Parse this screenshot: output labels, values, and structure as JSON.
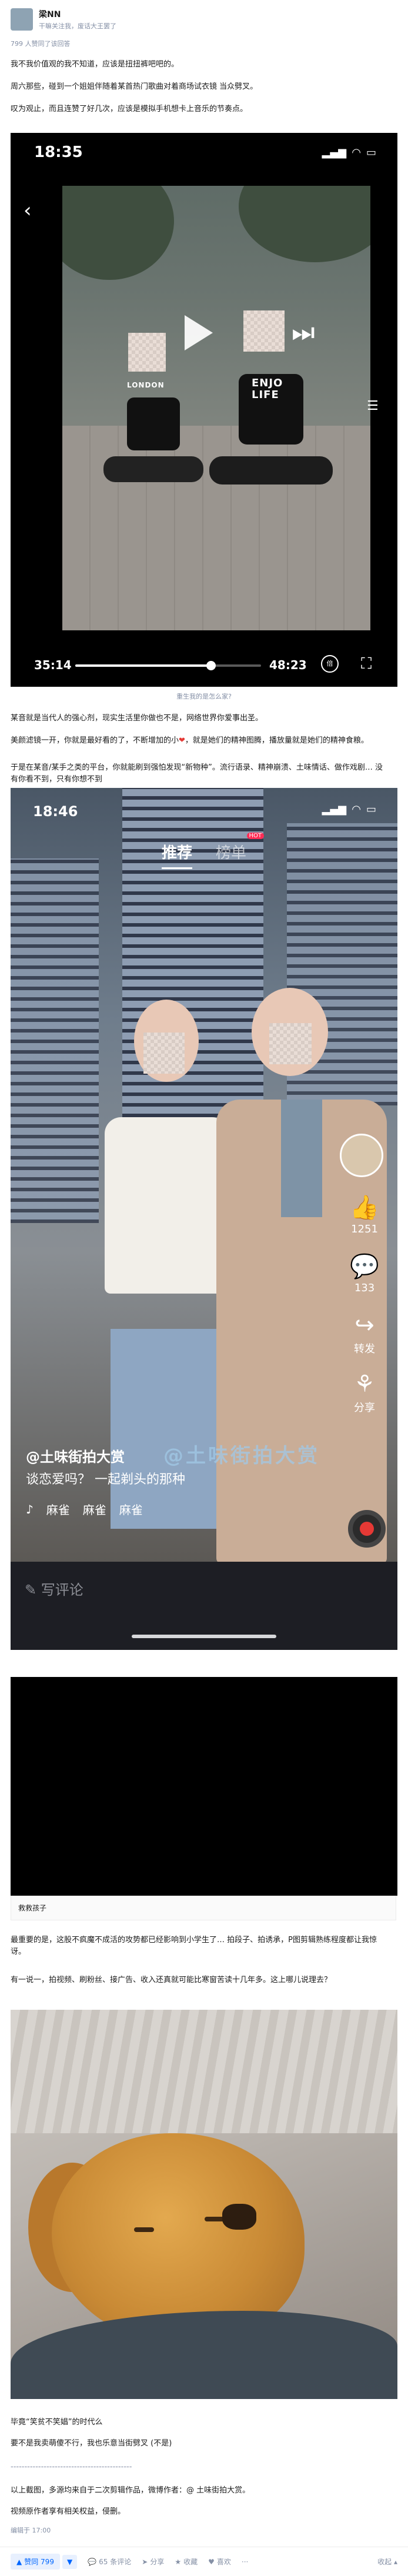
{
  "author": {
    "name": "梁NN",
    "bio": "干嘛关注我，废话大王罢了"
  },
  "vote_info": "799 人赞同了该回答",
  "paragraphs": {
    "p1": "我不我价值观的我不知道，应该是扭扭裤吧吧的。",
    "p2": "周六那些，碰到一个姐姐伴随着某首热门歌曲对着商场试衣镜 当众劈叉。",
    "p3": "叹为观止，而且连赞了好几次，应该是模拟手机想卡上音乐的节奏点。",
    "p4": "某音就是当代人的强心剂，现实生活里你做也不是，网络世界你爱事出圣。",
    "p5_a": "美颜滤镜一开，你就是最好看的了，不断增加的小",
    "p5_b": "，就是她们的精神图腾，播放量就是她们的精神食粮。",
    "p6": "于是在某音/某手之类的平台，你就能刷到强怕发现“新物种”。流行语录、精神崩溃、土味情话、做作戏剧… 没有你看不到，只有你想不到",
    "p7": "最重要的是，这股不疯魔不成活的攻势都已经影响到小学生了… 拍段子、拍诱承，P图剪辑熟练程度都让我惊讶。",
    "p8": "有一说一，拍视频、刷粉丝、接广告、收入还真就可能比寒窗苦读十几年多。这上哪儿说理去？",
    "p9": "毕竟“笑贫不笑娼”的时代么",
    "p10": "要不是我卖萌傻不行，我也乐意当街劈叉 (不是)",
    "p11": "--------------------------------------------",
    "p12": "以上截图，多源均来自于二次剪辑作品，微博作者：@ 土味街拍大赏。",
    "p13": "视频原作者享有相关权益，侵删。",
    "edited": "编辑于 17:00"
  },
  "video_player": {
    "status_time": "18:35",
    "status_icons": [
      "signal-icon",
      "wifi-icon",
      "battery-icon"
    ],
    "shirt_left": "LONDON",
    "shirt_right": "ENJO\nLIFE",
    "time_elapsed": "35:14",
    "time_total": "48:23",
    "speed_label": "倍",
    "progress": 0.73,
    "caption": "重生我的是怎么家?"
  },
  "app_video": {
    "status_time": "18:46",
    "tabs": [
      {
        "label": "推荐",
        "active": true
      },
      {
        "label": "榜单",
        "active": false,
        "badge": "HOT"
      }
    ],
    "like_count": "1251",
    "comment_count": "133",
    "share_label": "转发",
    "share2_label": "分享",
    "author": "@土味街拍大赏",
    "description": "谈恋爱吗？ 一起剃头的那种",
    "music": [
      "麻雀",
      "麻雀",
      "麻雀"
    ],
    "watermark": "@土味街拍大赏",
    "comment_placeholder": "写评论"
  },
  "video_card": {
    "title": "救救孩子"
  },
  "action_bar": {
    "upvote": "赞同 799",
    "comments": "65 条评论",
    "share": "分享",
    "favorite": "收藏",
    "like": "喜欢",
    "collapse": "收起"
  }
}
